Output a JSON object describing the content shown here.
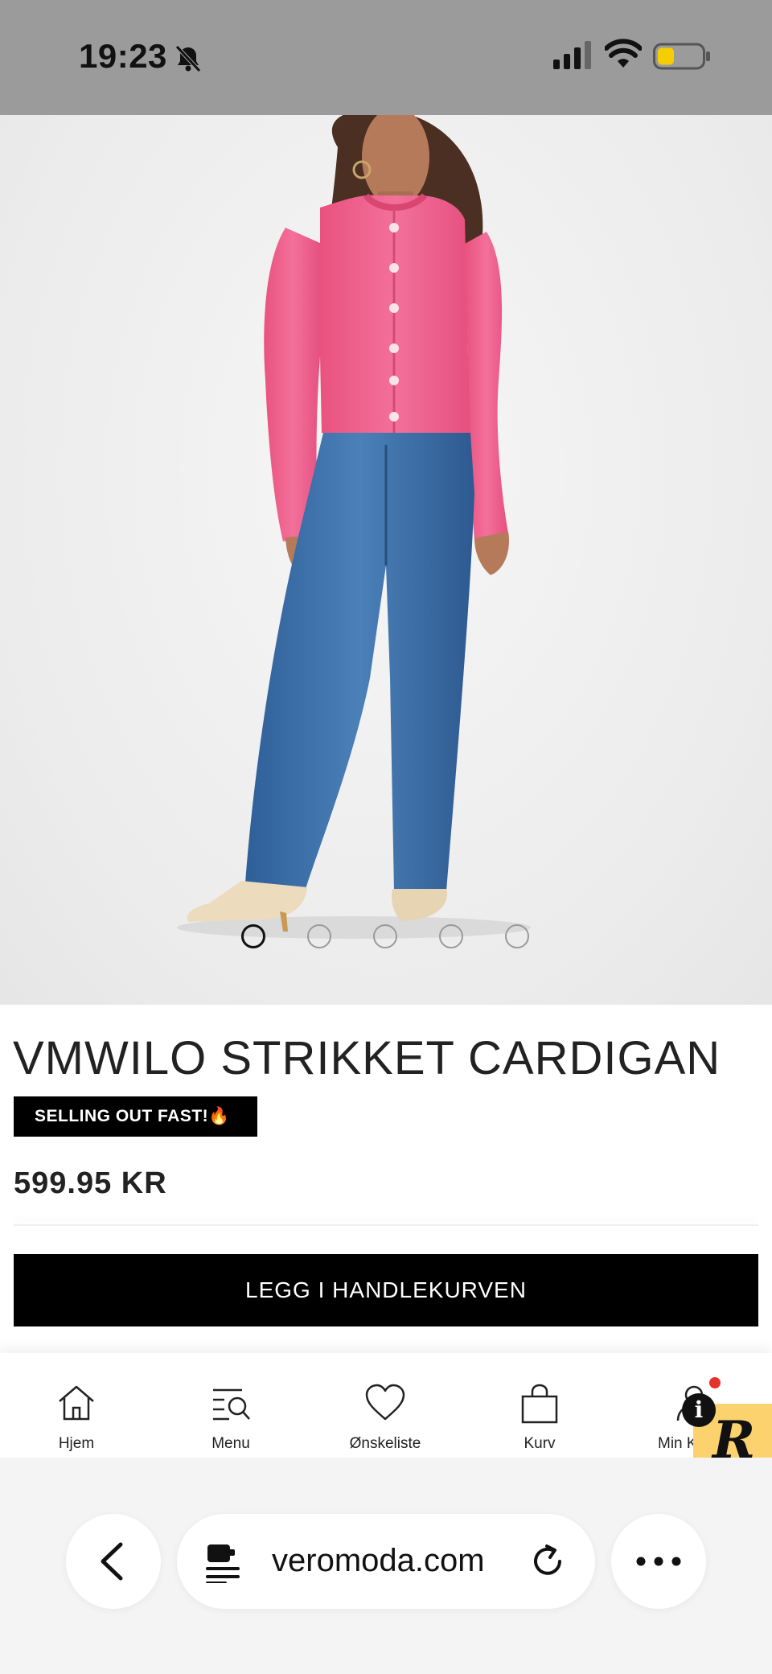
{
  "status_bar": {
    "time": "19:23",
    "icons": [
      "bell-slash-icon",
      "signal-icon",
      "wifi-icon",
      "battery-icon"
    ],
    "battery_color": "#f5cd00"
  },
  "product": {
    "title": "VMWILO STRIKKET CARDIGAN",
    "badge": "SELLING OUT FAST!🔥",
    "price": "599.95 KR",
    "add_to_cart_label": "LEGG I HANDLEKURVEN",
    "gallery": {
      "image_count": 5,
      "active_index": 0
    }
  },
  "bottom_nav": {
    "items": [
      {
        "label": "Hjem",
        "icon": "home-icon"
      },
      {
        "label": "Menu",
        "icon": "menu-search-icon"
      },
      {
        "label": "Ønskeliste",
        "icon": "heart-icon"
      },
      {
        "label": "Kurv",
        "icon": "bag-icon"
      },
      {
        "label": "Min K",
        "icon": "account-icon"
      }
    ]
  },
  "widget": {
    "letter": "R",
    "info": "i"
  },
  "browser": {
    "url": "veromoda.com",
    "icons": [
      "back-chevron-icon",
      "site-settings-icon",
      "reload-icon",
      "more-icon"
    ]
  },
  "colors": {
    "status_bar_bg": "#9b9b9b",
    "cardigan": "#f0608e",
    "jeans": "#3b6fa6",
    "cta_bg": "#000000",
    "widget_bg": "#fcd26e",
    "notification": "#e5322d"
  }
}
